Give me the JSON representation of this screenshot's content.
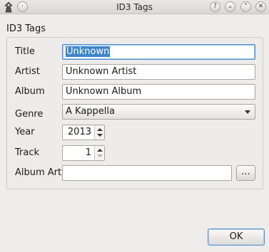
{
  "window": {
    "title": "ID3 Tags",
    "controls": {
      "help": "?",
      "minimize": "⌄",
      "maximize": "⌃",
      "close": "✕"
    },
    "menu_glyph": "·"
  },
  "group": {
    "title": "ID3 Tags"
  },
  "fields": {
    "title": {
      "label": "Title",
      "value": "Unknown"
    },
    "artist": {
      "label": "Artist",
      "value": "Unknown Artist"
    },
    "album": {
      "label": "Album",
      "value": "Unknown Album"
    },
    "genre": {
      "label": "Genre",
      "value": "A Kappella"
    },
    "year": {
      "label": "Year",
      "value": "2013"
    },
    "track": {
      "label": "Track",
      "value": "1"
    },
    "album_art": {
      "label": "Album Art",
      "value": "",
      "browse_label": "..."
    }
  },
  "buttons": {
    "ok": "OK"
  },
  "colors": {
    "selection": "#3e86cc",
    "focus_border": "#4a90d0"
  }
}
